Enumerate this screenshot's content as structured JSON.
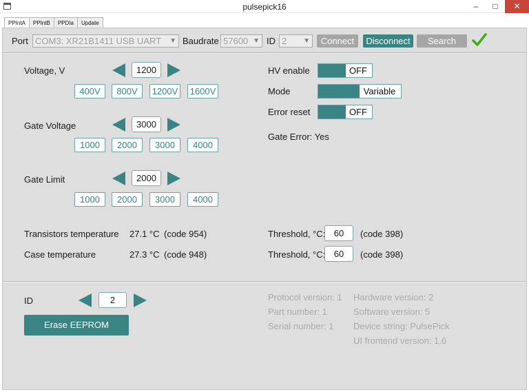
{
  "window": {
    "title": "pulsepick16",
    "minimize": "–",
    "maximize": "□",
    "close": "✕"
  },
  "tabs": [
    "PPIntA",
    "PPIntB",
    "PPDIa",
    "Update"
  ],
  "connection": {
    "port_label": "Port",
    "port_value": "COM3: XR21B1411 USB UART",
    "baudrate_label": "Baudrate",
    "baudrate_value": "57600",
    "id_label": "ID",
    "id_value": "2",
    "connect": "Connect",
    "disconnect": "Disconnect",
    "search": "Search",
    "status_icon": "checkmark-icon",
    "accent": "#3b8484",
    "check_color": "#4aa81c"
  },
  "voltage": {
    "label": "Voltage, V",
    "value": "1200",
    "presets": [
      "400V",
      "800V",
      "1200V",
      "1600V"
    ]
  },
  "gate_voltage": {
    "label": "Gate Voltage",
    "value": "3000",
    "presets": [
      "1000",
      "2000",
      "3000",
      "4000"
    ]
  },
  "gate_limit": {
    "label": "Gate Limit",
    "value": "2000",
    "presets": [
      "1000",
      "2000",
      "3000",
      "4000"
    ]
  },
  "temperatures": {
    "transistors_label": "Transistors temperature",
    "transistors_value": "27.1 °C",
    "transistors_code": "(code 954)",
    "case_label": "Case temperature",
    "case_value": "27.3 °C",
    "case_code": "(code 948)"
  },
  "controls": {
    "hv_label": "HV enable",
    "hv_state": "OFF",
    "mode_label": "Mode",
    "mode_state": "Variable",
    "error_reset_label": "Error reset",
    "error_reset_state": "OFF",
    "gate_error": "Gate Error: Yes"
  },
  "thresholds": {
    "label": "Threshold, °C:",
    "transistors_value": "60",
    "transistors_code": "(code 398)",
    "case_value": "60",
    "case_code": "(code 398)"
  },
  "device": {
    "id_label": "ID",
    "id_value": "2",
    "erase": "Erase EEPROM",
    "protocol_version": "Protocol version: 1",
    "part_number": "Part number: 1",
    "serial_number": "Serial number: 1",
    "hardware_version": "Hardware version: 2",
    "software_version": "Software version: 5",
    "device_string": "Device string: PulsePick",
    "ui_frontend_version": "UI frontend version: 1.6"
  }
}
